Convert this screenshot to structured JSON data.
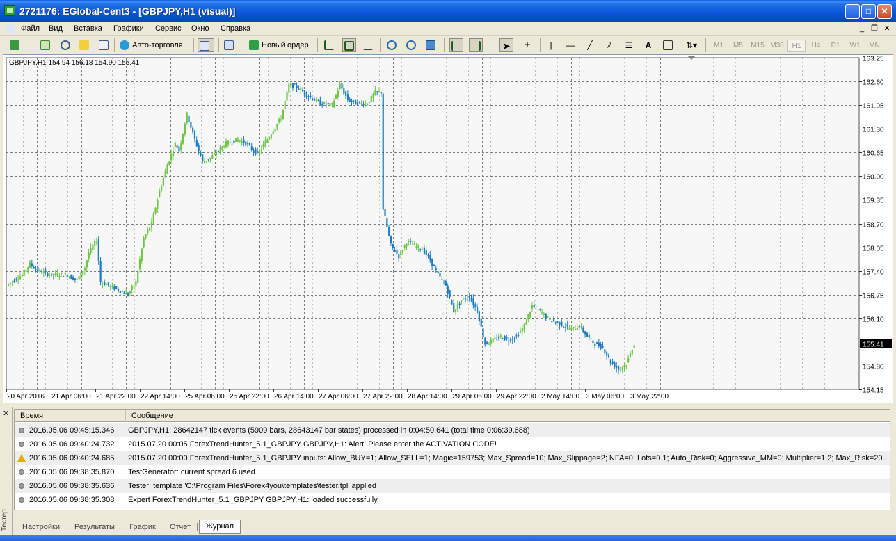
{
  "window": {
    "title": "2721176: EGlobal-Cent3 - [GBPJPY,H1 (visual)]",
    "buttons": {
      "minimize": "_",
      "maximize": "□",
      "close": "✕"
    }
  },
  "menu": {
    "items": [
      "Файл",
      "Вид",
      "Вставка",
      "Графики",
      "Сервис",
      "Окно",
      "Справка"
    ],
    "mdi": {
      "minimize": "_",
      "restore": "❐",
      "close": "✕"
    }
  },
  "toolbar": {
    "autotrade_label": "Авто-торговля",
    "new_order_label": "Новый ордер",
    "text_tool": "A",
    "timeframes": [
      "M1",
      "M5",
      "M15",
      "M30",
      "H1",
      "H4",
      "D1",
      "W1",
      "MN"
    ],
    "active_timeframe": "H1"
  },
  "chart_data": {
    "type": "candlestick",
    "symbol_info": "GBPJPY,H1  154.94 156.18 154.90 155.41",
    "current_price": "155.41",
    "current_price_value": 155.41,
    "ylim": [
      154.15,
      163.25
    ],
    "y_ticks": [
      "163.25",
      "162.60",
      "161.95",
      "161.30",
      "160.65",
      "160.00",
      "159.35",
      "158.70",
      "158.05",
      "157.40",
      "156.75",
      "156.10",
      "155.41",
      "154.80",
      "154.15"
    ],
    "x_ticks": [
      "20 Apr 2016",
      "21 Apr 06:00",
      "21 Apr 22:00",
      "22 Apr 14:00",
      "25 Apr 06:00",
      "25 Apr 22:00",
      "26 Apr 14:00",
      "27 Apr 06:00",
      "27 Apr 22:00",
      "28 Apr 14:00",
      "29 Apr 06:00",
      "29 Apr 22:00",
      "2 May 14:00",
      "3 May 06:00",
      "3 May 22:00"
    ],
    "path": [
      [
        0,
        157.0
      ],
      [
        8,
        157.3
      ],
      [
        12,
        157.6
      ],
      [
        16,
        157.4
      ],
      [
        22,
        157.3
      ],
      [
        30,
        157.3
      ],
      [
        36,
        157.15
      ],
      [
        40,
        157.5
      ],
      [
        42,
        157.9
      ],
      [
        46,
        158.25
      ],
      [
        48,
        157.1
      ],
      [
        54,
        156.95
      ],
      [
        58,
        156.85
      ],
      [
        62,
        156.75
      ],
      [
        66,
        157.1
      ],
      [
        70,
        158.3
      ],
      [
        74,
        158.7
      ],
      [
        78,
        159.6
      ],
      [
        82,
        160.3
      ],
      [
        86,
        160.9
      ],
      [
        88,
        160.7
      ],
      [
        92,
        161.7
      ],
      [
        96,
        161.0
      ],
      [
        100,
        160.4
      ],
      [
        104,
        160.5
      ],
      [
        108,
        160.7
      ],
      [
        112,
        160.9
      ],
      [
        118,
        161.0
      ],
      [
        122,
        160.9
      ],
      [
        126,
        160.7
      ],
      [
        128,
        160.6
      ],
      [
        134,
        161.1
      ],
      [
        140,
        161.6
      ],
      [
        144,
        162.5
      ],
      [
        148,
        162.45
      ],
      [
        154,
        162.2
      ],
      [
        160,
        162.0
      ],
      [
        166,
        161.95
      ],
      [
        170,
        162.5
      ],
      [
        174,
        162.1
      ],
      [
        178,
        162.0
      ],
      [
        184,
        162.0
      ],
      [
        188,
        162.3
      ],
      [
        191,
        162.3
      ],
      [
        192,
        159.1
      ],
      [
        196,
        158.1
      ],
      [
        200,
        157.8
      ],
      [
        204,
        158.2
      ],
      [
        208,
        158.1
      ],
      [
        212,
        158.0
      ],
      [
        216,
        157.7
      ],
      [
        220,
        157.3
      ],
      [
        224,
        157.0
      ],
      [
        228,
        156.3
      ],
      [
        232,
        156.6
      ],
      [
        236,
        156.7
      ],
      [
        240,
        156.3
      ],
      [
        244,
        155.4
      ],
      [
        248,
        155.5
      ],
      [
        252,
        155.6
      ],
      [
        256,
        155.5
      ],
      [
        260,
        155.6
      ],
      [
        264,
        155.9
      ],
      [
        268,
        156.45
      ],
      [
        272,
        156.3
      ],
      [
        276,
        156.1
      ],
      [
        280,
        156.0
      ],
      [
        284,
        155.9
      ],
      [
        288,
        155.8
      ],
      [
        292,
        155.9
      ],
      [
        296,
        155.6
      ],
      [
        300,
        155.4
      ],
      [
        304,
        155.3
      ],
      [
        308,
        154.9
      ],
      [
        312,
        154.7
      ],
      [
        316,
        154.85
      ],
      [
        320,
        155.41
      ]
    ]
  },
  "log": {
    "col_time": "Время",
    "col_message": "Сообщение",
    "rows": [
      {
        "time": "2016.05.06 09:45:15.346",
        "msg": "GBPJPY,H1: 28642147 tick events (5909 bars, 28643147 bar states) processed in 0:04:50.641 (total time 0:06:39.688)",
        "level": "info"
      },
      {
        "time": "2016.05.06 09:40:24.732",
        "msg": "2015.07.20 00:05  ForexTrendHunter_5.1_GBPJPY GBPJPY,H1: Alert: Please enter the ACTIVATION CODE!",
        "level": "info"
      },
      {
        "time": "2016.05.06 09:40:24.685",
        "msg": "2015.07.20 00:00  ForexTrendHunter_5.1_GBPJPY inputs: Allow_BUY=1; Allow_SELL=1; Magic=159753; Max_Spread=10; Max_Slippage=2; NFA=0; Lots=0.1; Auto_Risk=0; Aggressive_MM=0; Multiplier=1.2; Max_Risk=20...",
        "level": "warning"
      },
      {
        "time": "2016.05.06 09:38:35.870",
        "msg": "TestGenerator: current spread 6 used",
        "level": "info"
      },
      {
        "time": "2016.05.06 09:38:35.636",
        "msg": "Tester: template 'C:\\Program Files\\Forex4you\\templates\\tester.tpl' applied",
        "level": "info"
      },
      {
        "time": "2016.05.06 09:38:35.308",
        "msg": "Expert ForexTrendHunter_5.1_GBPJPY GBPJPY,H1: loaded successfully",
        "level": "info"
      }
    ]
  },
  "panel": {
    "side_label": "Тестер",
    "close": "✕",
    "tabs": [
      "Настройки",
      "Результаты",
      "График",
      "Отчет",
      "Журнал"
    ],
    "active_tab": "Журнал"
  },
  "colors": {
    "bull": "#6cc644",
    "bear": "#1a7cc1",
    "grid": "#7a7a7a"
  }
}
